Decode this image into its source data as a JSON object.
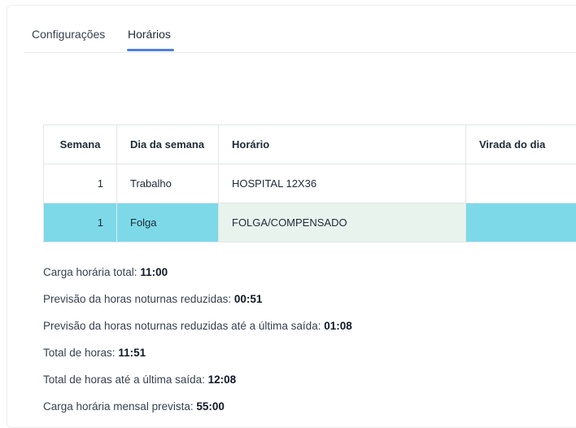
{
  "tabs": [
    {
      "label": "Configurações",
      "active": false
    },
    {
      "label": "Horários",
      "active": true
    }
  ],
  "accent_color": "#4f7fdc",
  "table": {
    "headers": [
      "Semana",
      "Dia da semana",
      "Horário",
      "Virada do dia"
    ],
    "rows": [
      {
        "semana": "1",
        "dia": "Trabalho",
        "horario": "HOSPITAL 12X36",
        "virada": "",
        "highlight": false
      },
      {
        "semana": "1",
        "dia": "Folga",
        "horario": "FOLGA/COMPENSADO",
        "virada": "",
        "highlight": true
      }
    ],
    "highlight_color": "#7dd9e8"
  },
  "summary": [
    {
      "label": "Carga horária total: ",
      "value": "11:00"
    },
    {
      "label": "Previsão da horas noturnas reduzidas: ",
      "value": "00:51"
    },
    {
      "label": "Previsão da horas noturnas reduzidas até a última saída: ",
      "value": "01:08"
    },
    {
      "label": "Total de horas: ",
      "value": "11:51"
    },
    {
      "label": "Total de horas até a última saída: ",
      "value": "12:08"
    },
    {
      "label": "Carga horária mensal prevista: ",
      "value": "55:00"
    }
  ]
}
